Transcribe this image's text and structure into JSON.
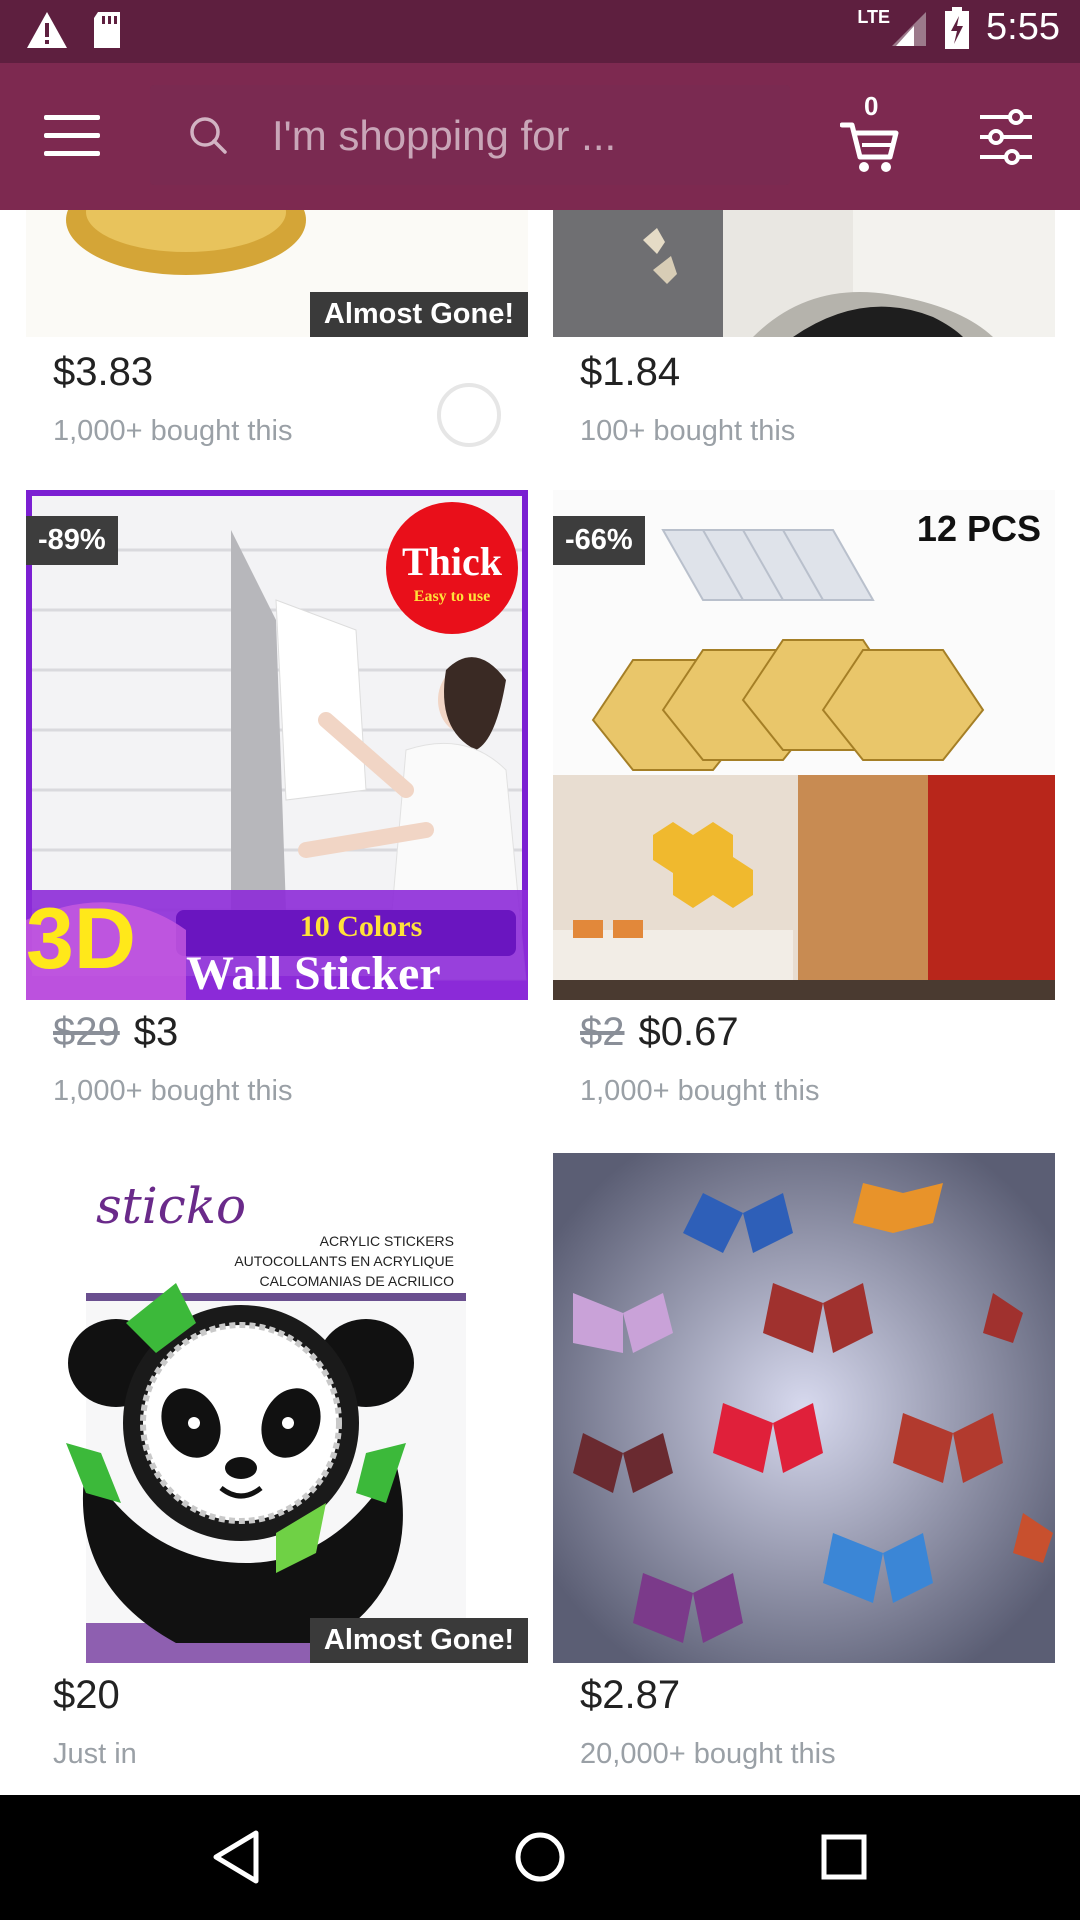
{
  "status_bar": {
    "time": "5:55",
    "network": "LTE"
  },
  "toolbar": {
    "search_placeholder": "I'm shopping for ...",
    "cart_count": "0"
  },
  "products": [
    {
      "price": "$3.83",
      "original_price": "",
      "sold": "1,000+ bought this",
      "badge": "Almost Gone!",
      "discount": ""
    },
    {
      "price": "$1.84",
      "original_price": "",
      "sold": "100+ bought this",
      "badge": "",
      "discount": ""
    },
    {
      "price": "$3",
      "original_price": "$29",
      "sold": "1,000+ bought this",
      "badge": "",
      "discount": "-89%",
      "img_text": {
        "thick": "Thick",
        "easy": "Easy to use",
        "colors": "10 Colors",
        "title_3d": "3D",
        "title": "Wall Sticker"
      }
    },
    {
      "price": "$0.67",
      "original_price": "$2",
      "sold": "1,000+ bought this",
      "badge": "",
      "discount": "-66%",
      "img_text": {
        "pcs": "12 PCS"
      }
    },
    {
      "price": "$20",
      "original_price": "",
      "sold": "Just in",
      "badge": "Almost Gone!",
      "discount": "",
      "img_text": {
        "brand": "sticko",
        "line1": "ACRYLIC STICKERS",
        "line2": "AUTOCOLLANTS EN ACRYLIQUE",
        "line3": "CALCOMANIAS DE ACRILICO"
      }
    },
    {
      "price": "$2.87",
      "original_price": "",
      "sold": "20,000+ bought this",
      "badge": "",
      "discount": ""
    }
  ],
  "colors": {
    "status_bar": "#5e1f3f",
    "toolbar": "#7d2950",
    "price_text": "#222222",
    "sold_text": "#9aa0a6",
    "badge_bg": "#3a3a3a"
  },
  "icons": [
    "warning-icon",
    "sd-card-icon",
    "signal-icon",
    "battery-icon",
    "menu-icon",
    "search-icon",
    "cart-icon",
    "filter-icon",
    "back-icon",
    "home-icon",
    "recents-icon"
  ]
}
